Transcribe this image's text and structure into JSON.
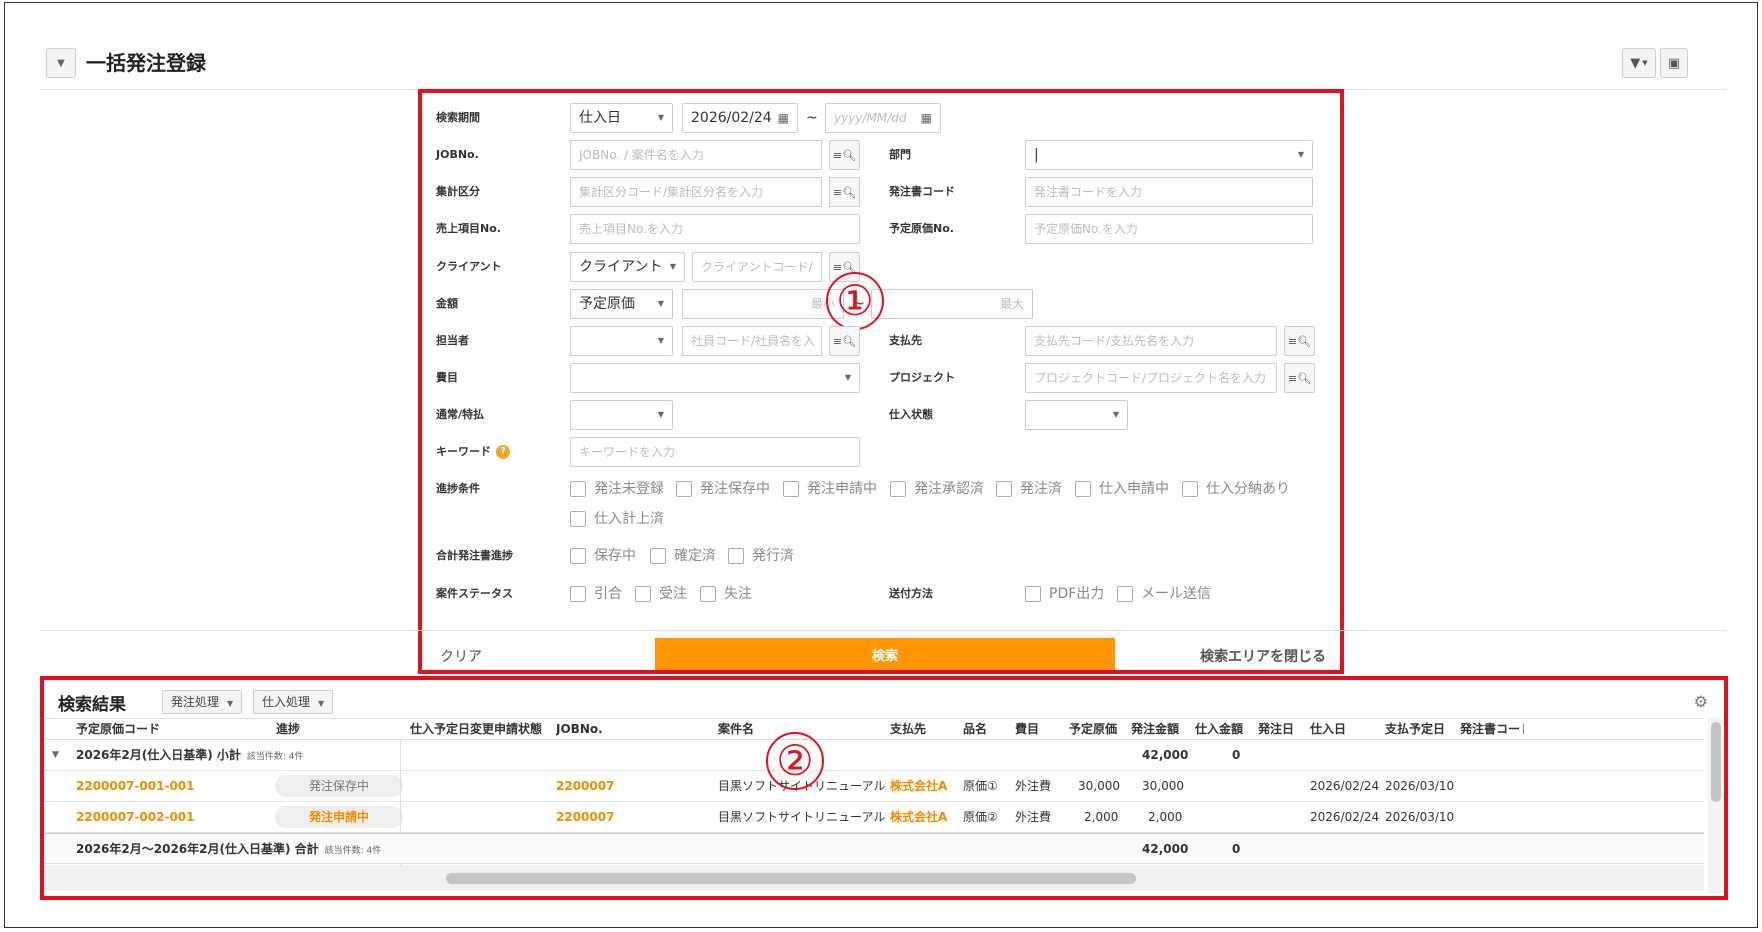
{
  "header": {
    "title": "一括発注登録"
  },
  "search": {
    "period_label": "検索期間",
    "period_type": "仕入日",
    "date_from": "2026/02/24",
    "tilde": "~",
    "date_to_placeholder": "yyyy/MM/dd",
    "jobno_label": "JOBNo.",
    "jobno_placeholder": "JOBNo. / 案件名を入力",
    "dept_label": "部門",
    "dept_value": "|",
    "agg_label": "集計区分",
    "agg_placeholder": "集計区分コード/集計区分名を入力",
    "po_code_label": "発注書コード",
    "po_code_placeholder": "発注書コードを入力",
    "sales_item_label": "売上項目No.",
    "sales_item_placeholder": "売上項目No.を入力",
    "planned_cost_label": "予定原価No.",
    "planned_cost_placeholder": "予定原価No.を入力",
    "client_label": "クライアント",
    "client_type": "クライアント",
    "client_placeholder": "クライアントコード/",
    "amount_label": "金額",
    "amount_type": "予定原価",
    "amount_min_placeholder": "最小",
    "amount_max_placeholder": "最大",
    "staff_label": "担当者",
    "staff_placeholder": "社員コード/社員名を入",
    "vendor_label": "支払先",
    "vendor_placeholder": "支払先コード/支払先名を入力",
    "expense_label": "費目",
    "project_label": "プロジェクト",
    "project_placeholder": "プロジェクトコード/プロジェクト名を入力",
    "normal_label": "通常/特払",
    "purchase_state_label": "仕入状態",
    "keyword_label": "キーワード",
    "keyword_placeholder": "キーワードを入力",
    "progress_label": "進捗条件",
    "progress_options": [
      "発注未登録",
      "発注保存中",
      "発注申請中",
      "発注承認済",
      "発注済",
      "仕入申請中",
      "仕入分納あり",
      "仕入計上済"
    ],
    "total_progress_label": "合計発注書進捗",
    "total_progress_options": [
      "保存中",
      "確定済",
      "発行済"
    ],
    "case_status_label": "案件ステータス",
    "case_status_options": [
      "引合",
      "受注",
      "失注"
    ],
    "send_method_label": "送付方法",
    "send_method_options": [
      "PDF出力",
      "メール送信"
    ],
    "clear_label": "クリア",
    "search_label": "検索",
    "close_label": "検索エリアを閉じる",
    "annotation_1": "①"
  },
  "results": {
    "title": "検索結果",
    "order_process_label": "発注処理",
    "purchase_process_label": "仕入処理",
    "annotation_2": "②",
    "columns": [
      "予定原価コード",
      "進捗",
      "仕入予定日変更申請状態",
      "JOBNo.",
      "案件名",
      "支払先",
      "品名",
      "費目",
      "予定原価",
      "発注金額",
      "仕入金額",
      "発注日",
      "仕入日",
      "支払予定日",
      "発注書コード"
    ],
    "subtotal": {
      "label": "2026年2月(仕入日基準) 小計",
      "count": "該当件数: 4件",
      "order_amount": "42,000",
      "purchase_amount": "0"
    },
    "rows": [
      {
        "code": "2200007-001-001",
        "status": "発注保存中",
        "job": "2200007",
        "case": "目黒ソフトサイトリニューアル",
        "vendor": "株式会社A",
        "item": "原価①",
        "expense": "外注費",
        "planned": "30,000",
        "order": "30,000",
        "purchase_date": "2026/02/24",
        "pay_date": "2026/03/10"
      },
      {
        "code": "2200007-002-001",
        "status": "発注申請中",
        "job": "2200007",
        "case": "目黒ソフトサイトリニューアル",
        "vendor": "株式会社A",
        "item": "原価②",
        "expense": "外注費",
        "planned": "2,000",
        "order": "2,000",
        "purchase_date": "2026/02/24",
        "pay_date": "2026/03/10"
      }
    ],
    "total": {
      "label": "2026年2月～2026年2月(仕入日基準) 合計",
      "count": "該当件数: 4件",
      "order_amount": "42,000",
      "purchase_amount": "0"
    }
  }
}
